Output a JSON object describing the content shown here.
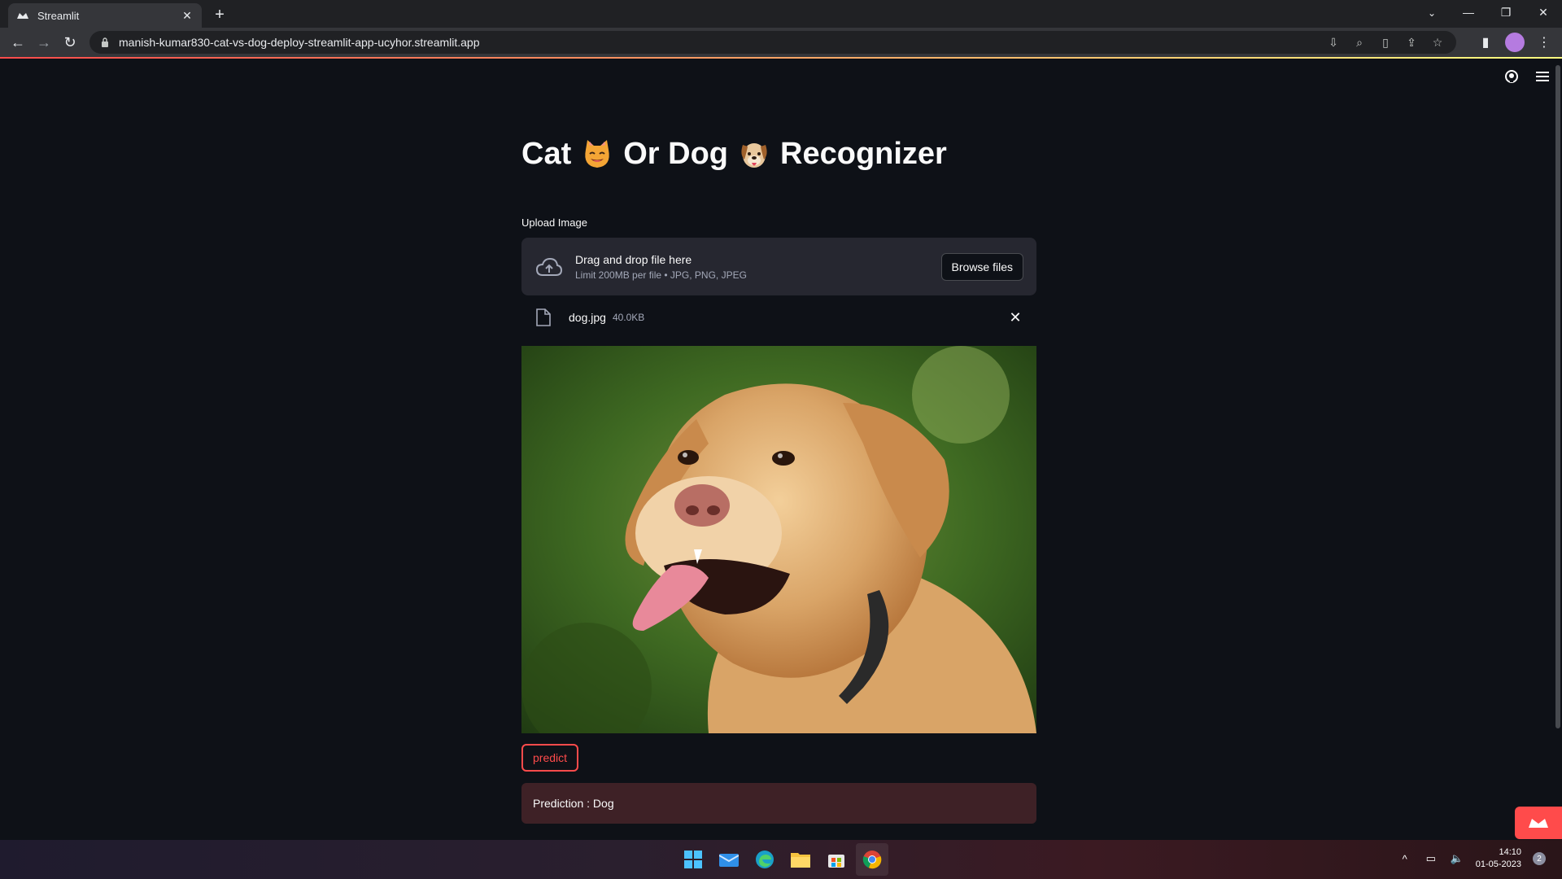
{
  "browser": {
    "tab_title": "Streamlit",
    "url": "manish-kumar830-cat-vs-dog-deploy-streamlit-app-ucyhor.streamlit.app"
  },
  "app": {
    "title_part1": "Cat",
    "title_part2": "Or Dog",
    "title_part3": "Recognizer",
    "uploader": {
      "label": "Upload Image",
      "drag_text": "Drag and drop file here",
      "limit_text": "Limit 200MB per file • JPG, PNG, JPEG",
      "browse_label": "Browse files"
    },
    "file": {
      "name": "dog.jpg",
      "size": "40.0KB"
    },
    "predict_label": "predict",
    "prediction_text": "Prediction : Dog"
  },
  "taskbar": {
    "time": "14:10",
    "date": "01-05-2023",
    "notifications": "2"
  },
  "colors": {
    "primary": "#ff4b4b",
    "background": "#0e1117",
    "secondary_bg": "#262730"
  }
}
